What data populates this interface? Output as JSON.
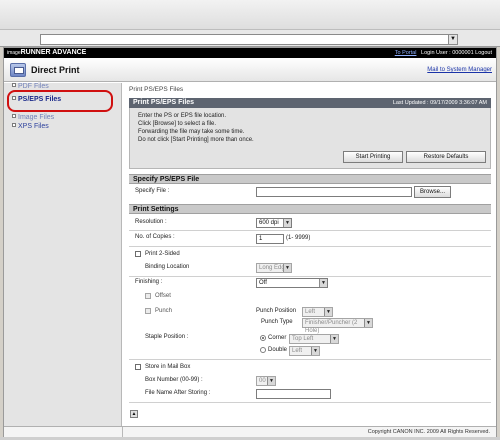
{
  "brand": {
    "logo_prefix": "image",
    "logo_name": "RUNNER ADVANCE",
    "to_portal": "To Portal",
    "login_label": "Login User : 0000001 Logout"
  },
  "header": {
    "title": "Direct Print",
    "mail_link": "Mail to System Manager"
  },
  "sidebar": {
    "items": [
      {
        "label": "PDF Files"
      },
      {
        "label": "PS/EPS Files"
      },
      {
        "label": "Image Files"
      },
      {
        "label": "XPS Files"
      }
    ]
  },
  "breadcrumb": "Print PS/EPS Files",
  "panel": {
    "title": "Print PS/EPS Files",
    "updated": "Last Updated : 09/17/2009 3:36:07 AM",
    "instructions": [
      "Enter the PS or EPS file location.",
      "Click [Browse] to select a file.",
      "Forwarding the file may take some time.",
      "Do not click [Start Printing] more than once."
    ],
    "start_button": "Start Printing",
    "restore_button": "Restore Defaults"
  },
  "specify": {
    "section_title": "Specify PS/EPS File",
    "label": "Specify File :",
    "value": "",
    "browse_button": "Browse..."
  },
  "settings": {
    "section_title": "Print Settings",
    "resolution_label": "Resolution :",
    "resolution_value": "600 dpi",
    "copies_label": "No. of Copies :",
    "copies_value": "1",
    "copies_range": "(1- 9999)",
    "two_sided_label": "Print 2-Sided",
    "binding_label": "Binding Location",
    "binding_value": "Long Edge",
    "finishing_label": "Finishing :",
    "finishing_value": "Off",
    "offset_label": "Offset",
    "punch_label": "Punch",
    "punch_position_label": "Punch Position",
    "punch_position_value": "Left",
    "punch_type_label": "Punch Type",
    "punch_type_value": "Finisher/Puncher (2 Hole)",
    "staple_label": "Staple Position :",
    "corner_label": "Corner",
    "corner_value": "Top Left",
    "double_label": "Double",
    "double_value": "Left",
    "mailbox_label": "Store in Mail Box",
    "box_number_label": "Box Number (00-99) :",
    "box_number_value": "00",
    "file_name_label": "File Name After Storing :",
    "file_name_value": ""
  },
  "footer": {
    "copyright": "Copyright CANON INC. 2009 All Rights Reserved."
  },
  "icons": {
    "dropdown": "chevron-down-icon",
    "top": "arrow-up-icon"
  }
}
